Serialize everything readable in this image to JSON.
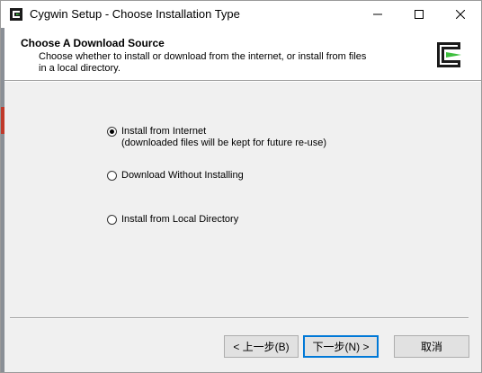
{
  "window": {
    "title": "Cygwin Setup - Choose Installation Type",
    "controls": {
      "minimize": "minimize-icon",
      "maximize": "maximize-icon",
      "close": "close-icon"
    }
  },
  "header": {
    "title": "Choose A Download Source",
    "description": "Choose whether to install or download from the internet, or install from files in a local directory."
  },
  "options": [
    {
      "label": "Install from Internet",
      "sublabel": "(downloaded files will be kept for future re-use)",
      "checked": true
    },
    {
      "label": "Download Without Installing",
      "checked": false
    },
    {
      "label": "Install from Local Directory",
      "checked": false
    }
  ],
  "buttons": {
    "back": "< 上一步(B)",
    "next": "下一步(N) >",
    "cancel": "取消"
  },
  "colors": {
    "accent": "#0078d7",
    "logo_green": "#3fbf3f",
    "logo_dark": "#1a1a1a"
  }
}
